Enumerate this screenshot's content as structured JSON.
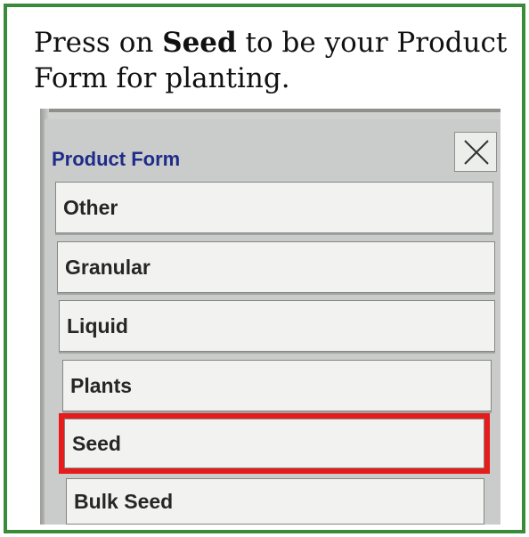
{
  "instruction": {
    "prefix": "Press on ",
    "emphasis": "Seed",
    "suffix": " to be your Product Form for planting."
  },
  "dialog": {
    "title": "Product Form",
    "close_icon": "close-x-icon",
    "options": [
      "Other",
      "Granular",
      "Liquid",
      "Plants",
      "Seed",
      "Bulk Seed"
    ],
    "highlighted_option": "Seed"
  },
  "colors": {
    "border_green": "#3a8a3a",
    "highlight_red": "#e61c1c",
    "title_blue": "#1f2c8a"
  }
}
